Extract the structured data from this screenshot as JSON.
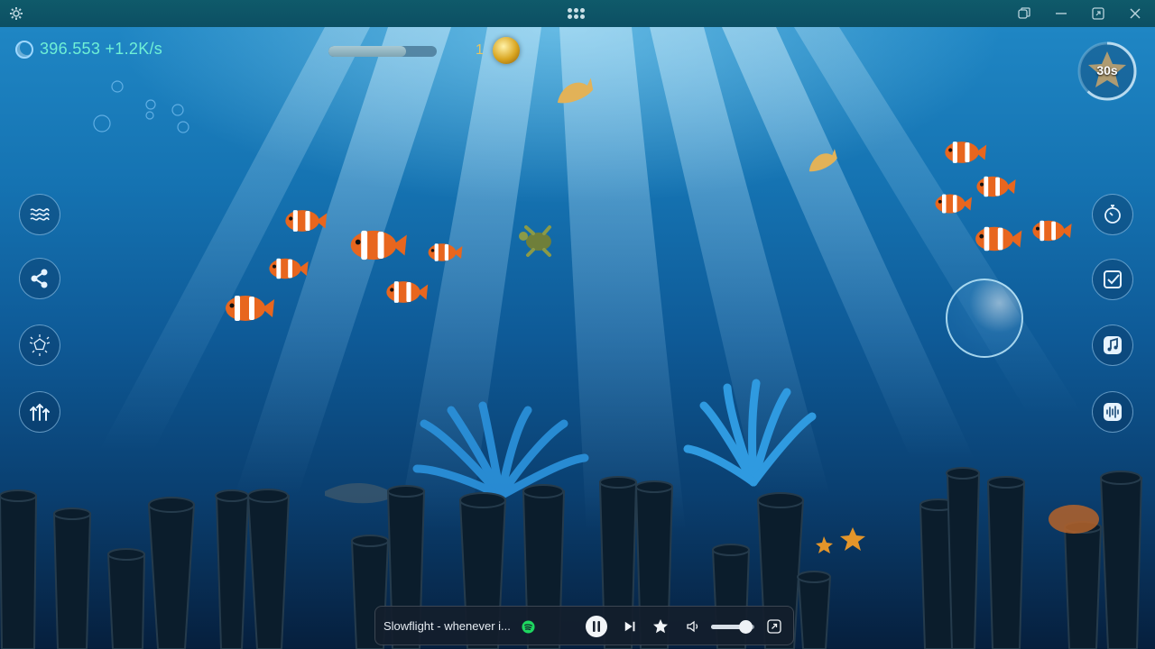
{
  "window": {
    "settings_icon": "gear-icon",
    "menu_icon": "grid-dots-icon",
    "controls": [
      "restore-icon",
      "minimize-icon",
      "resize-icon",
      "close-icon"
    ]
  },
  "hud": {
    "score": "396.553 +1.2K/s",
    "progress": 0.72,
    "coins": "1",
    "timer": "30s",
    "timer_fraction": 0.62
  },
  "left_buttons": [
    {
      "name": "waves-button",
      "icon": "waves-icon"
    },
    {
      "name": "share-button",
      "icon": "share-icon"
    },
    {
      "name": "effects-button",
      "icon": "sparkle-pentagon-icon"
    },
    {
      "name": "adjust-button",
      "icon": "sliders-icon"
    }
  ],
  "right_buttons": [
    {
      "name": "stopwatch-button",
      "icon": "stopwatch-icon"
    },
    {
      "name": "tasks-button",
      "icon": "checkbox-icon"
    },
    {
      "name": "music-button",
      "icon": "music-note-icon"
    },
    {
      "name": "ambient-sound-button",
      "icon": "soundwave-icon"
    }
  ],
  "player": {
    "track": "Slowflight - whenever i...",
    "source_icon": "spotify-icon",
    "volume": 0.8
  },
  "colors": {
    "score": "#6ff0d6",
    "coin_count": "#e8c560",
    "clownfish": "#e8661e",
    "accent": "#9fd8ff"
  }
}
